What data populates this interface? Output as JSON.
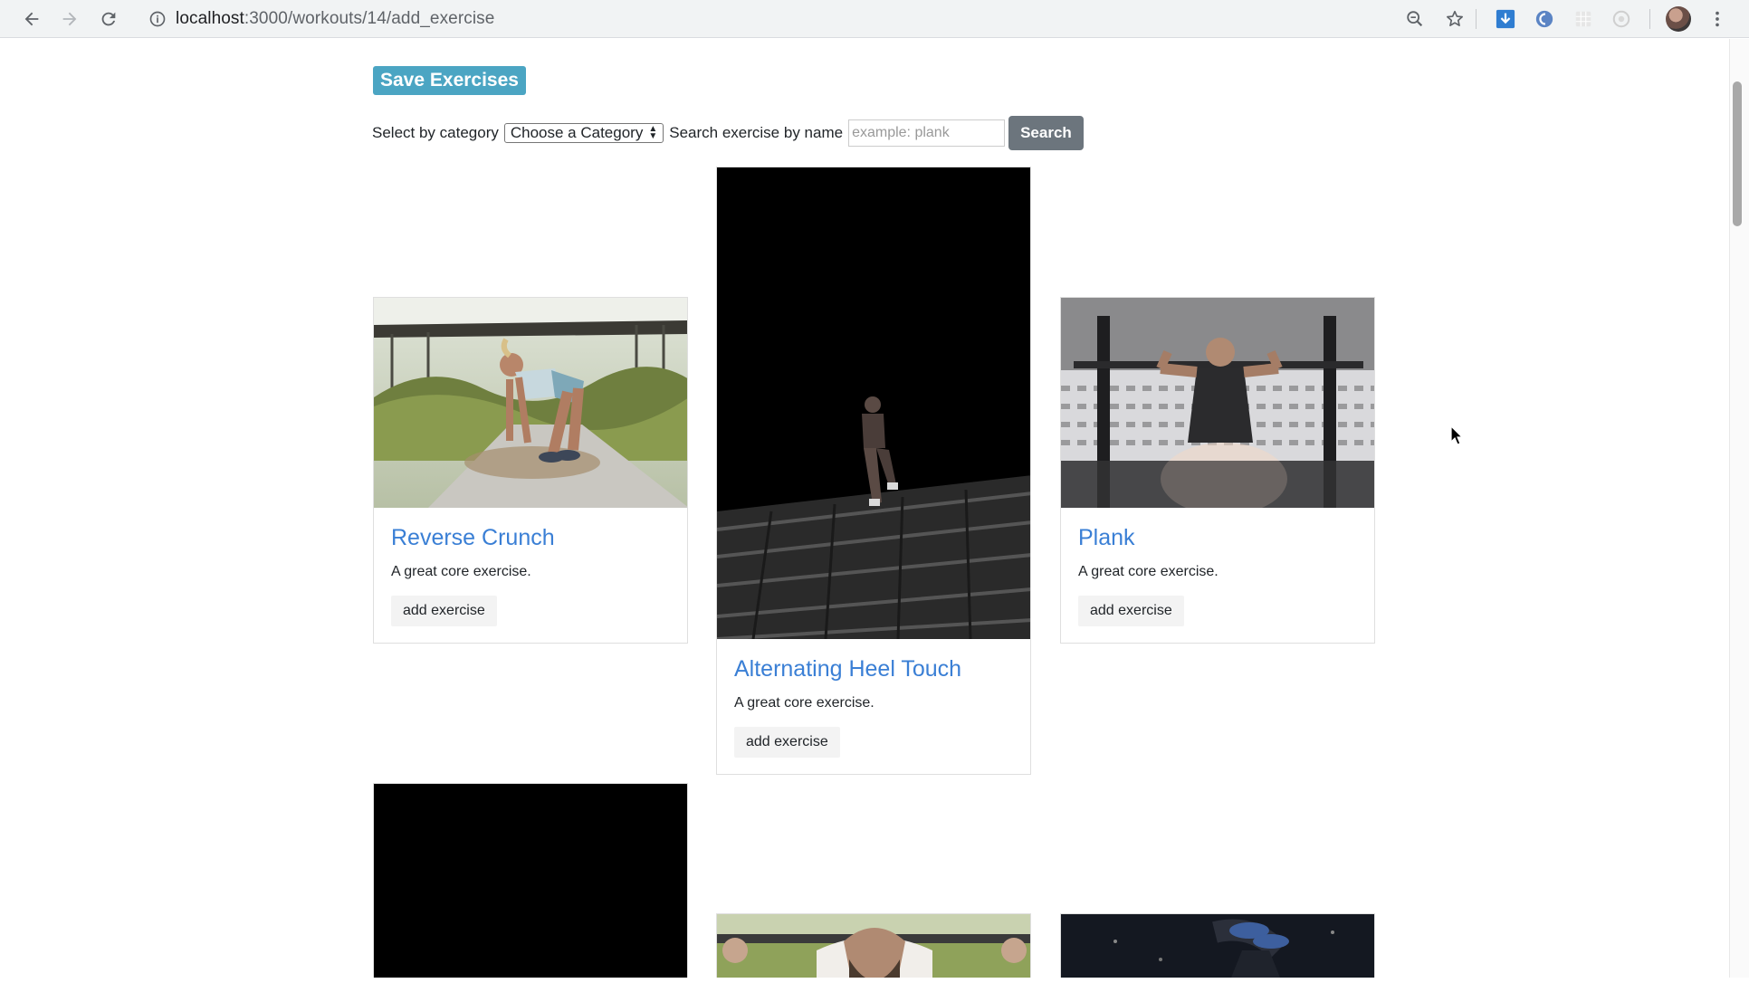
{
  "browser": {
    "url_host": "localhost",
    "url_path": ":3000/workouts/14/add_exercise"
  },
  "page": {
    "save_label": "Save Exercises",
    "category_label": "Select by category",
    "category_selected": "Choose a Category",
    "search_label": "Search exercise by name",
    "search_placeholder": "example: plank",
    "search_button": "Search"
  },
  "exercises": [
    {
      "title": "Reverse Crunch",
      "description": "A great core exercise.",
      "action": "add exercise"
    },
    {
      "title": "Alternating Heel Touch",
      "description": "A great core exercise.",
      "action": "add exercise"
    },
    {
      "title": "Plank",
      "description": "A great core exercise.",
      "action": "add exercise"
    }
  ],
  "colors": {
    "save_button": "#4ba5c3",
    "search_button": "#6c757d",
    "card_title": "#3a7fd5"
  },
  "icons": [
    "back-icon",
    "forward-icon",
    "reload-icon",
    "info-icon",
    "zoom-icon",
    "star-icon",
    "download-extension-icon",
    "extension-icon",
    "avatar",
    "menu-icon"
  ]
}
